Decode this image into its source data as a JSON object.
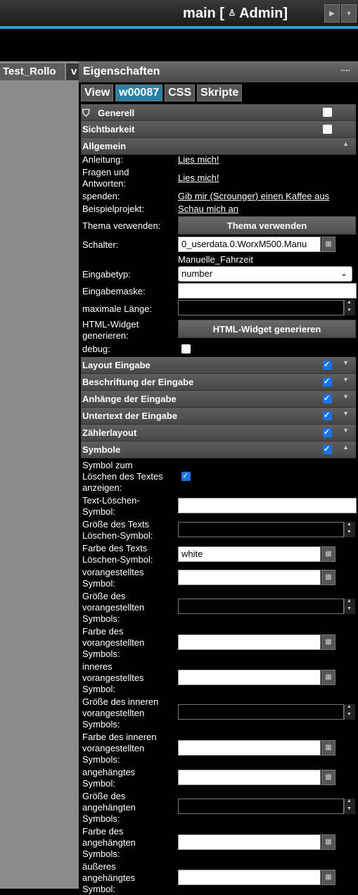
{
  "header": {
    "title": "main [",
    "user_icon": "user-icon",
    "admin": "Admin]",
    "play": "▶",
    "dropdown": "▾"
  },
  "left": {
    "tab1": "Test_Rollo",
    "tab2": "v"
  },
  "panel": {
    "title": "Eigenschaften",
    "tabs": [
      "View",
      "w00087",
      "CSS",
      "Skripte"
    ],
    "sections_top": [
      {
        "label": "Generell"
      },
      {
        "label": "Sichtbarkeit"
      },
      {
        "label": "Allgemein"
      }
    ],
    "allgemein": {
      "anleitung_label": "Anleitung:",
      "anleitung_link": "Lies mich!",
      "fragen_label_1": "Fragen und",
      "fragen_label_2": "Antworten:",
      "fragen_link": "Lies mich!",
      "spenden_label": "spenden:",
      "spenden_link": "Gib mir (Scrounger) einen Kaffee aus",
      "beispiel_label": "Beispielprojekt:",
      "beispiel_link": "Schau mich an",
      "thema_label": "Thema verwenden:",
      "thema_button": "Thema verwenden",
      "schalter_label": "Schalter:",
      "schalter_value": "0_userdata.0.WorxM500.Manu",
      "schalter_sub": "Manuelle_Fahrzeit",
      "eingabetyp_label": "Eingabetyp:",
      "eingabetyp_value": "number",
      "eingabemaske_label": "Eingabemaske:",
      "maxlen_label": "maximale Länge:",
      "html_label_1": "HTML-Widget",
      "html_label_2": "generieren:",
      "html_button": "HTML-Widget generieren",
      "debug_label": "debug:"
    },
    "sections_mid": [
      {
        "label": "Layout Eingabe"
      },
      {
        "label": "Beschriftung der Eingabe"
      },
      {
        "label": "Anhänge der Eingabe"
      },
      {
        "label": "Untertext der Eingabe"
      },
      {
        "label": "Zählerlayout"
      },
      {
        "label": "Symbole"
      }
    ],
    "symbole": {
      "l1a": "Symbol zum",
      "l1b": "Löschen des Textes",
      "l1c": "anzeigen:",
      "l2a": "Text-Löschen-",
      "l2b": "Symbol:",
      "l3a": "Größe des Texts",
      "l3b": "Löschen-Symbol:",
      "l4a": "Farbe des Texts",
      "l4b": "Löschen-Symbol:",
      "l4_value": "white",
      "l5a": "vorangestelltes",
      "l5b": "Symbol:",
      "l6a": "Größe des",
      "l6b": "vorangestellten",
      "l6c": "Symbols:",
      "l7a": "Farbe des",
      "l7b": "vorangestellten",
      "l7c": "Symbols:",
      "l8a": "inneres",
      "l8b": "vorangestelltes",
      "l8c": "Symbol:",
      "l9a": "Größe des inneren",
      "l9b": "vorangestellten",
      "l9c": "Symbols:",
      "l10a": "Farbe des inneren",
      "l10b": "vorangestellten",
      "l10c": "Symbols:",
      "l11a": "angehängtes",
      "l11b": "Symbol:",
      "l12a": "Größe des",
      "l12b": "angehängten",
      "l12c": "Symbols:",
      "l13a": "Farbe des",
      "l13b": "angehängten",
      "l13c": "Symbols:",
      "l14a": "äußeres",
      "l14b": "angehängtes",
      "l14c": "Symbol:"
    }
  }
}
